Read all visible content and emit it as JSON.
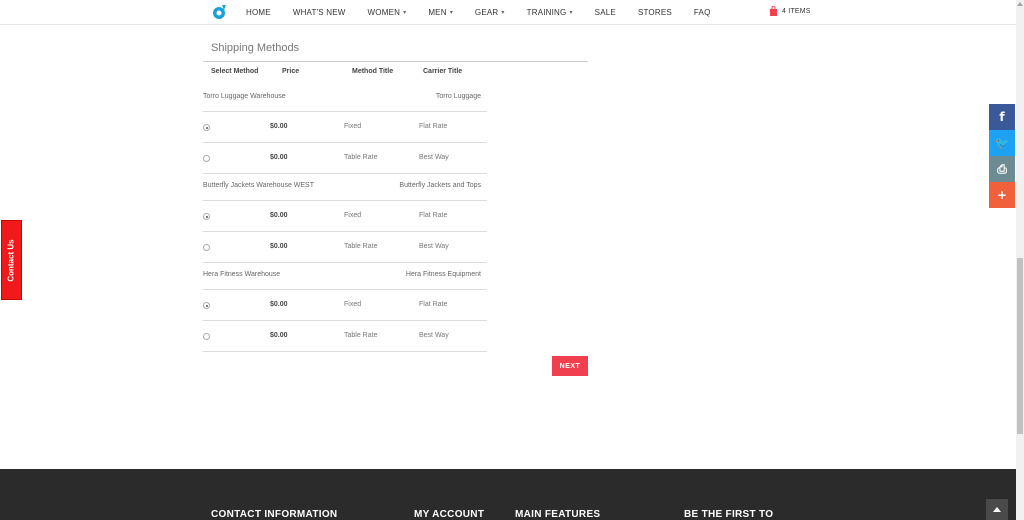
{
  "header": {
    "nav": [
      {
        "label": "HOME",
        "dropdown": false
      },
      {
        "label": "WHAT'S NEW",
        "dropdown": false
      },
      {
        "label": "WOMEN",
        "dropdown": true
      },
      {
        "label": "MEN",
        "dropdown": true
      },
      {
        "label": "GEAR",
        "dropdown": true
      },
      {
        "label": "TRAINING",
        "dropdown": true
      },
      {
        "label": "SALE",
        "dropdown": false
      },
      {
        "label": "STORES",
        "dropdown": false
      },
      {
        "label": "FAQ",
        "dropdown": false
      }
    ],
    "cart_label": "4 ITEMS"
  },
  "shipping": {
    "title": "Shipping Methods",
    "columns": [
      "Select Method",
      "Price",
      "Method Title",
      "Carrier Title"
    ],
    "warehouses": [
      {
        "name": "Torro Luggage Warehouse",
        "carrier": "Torro Luggage",
        "methods": [
          {
            "selected": true,
            "price": "$0.00",
            "method": "Fixed",
            "carrier": "Flat Rate"
          },
          {
            "selected": false,
            "price": "$0.00",
            "method": "Table Rate",
            "carrier": "Best Way"
          }
        ]
      },
      {
        "name": "Butterfly Jackets Warehouse WEST",
        "carrier": "Butterfly Jackets and Tops",
        "methods": [
          {
            "selected": true,
            "price": "$0.00",
            "method": "Fixed",
            "carrier": "Flat Rate"
          },
          {
            "selected": false,
            "price": "$0.00",
            "method": "Table Rate",
            "carrier": "Best Way"
          }
        ]
      },
      {
        "name": "Hera Fitness Warehouse",
        "carrier": "Hera Fitness Equipment",
        "methods": [
          {
            "selected": true,
            "price": "$0.00",
            "method": "Fixed",
            "carrier": "Flat Rate"
          },
          {
            "selected": false,
            "price": "$0.00",
            "method": "Table Rate",
            "carrier": "Best Way"
          }
        ]
      }
    ],
    "next_label": "NEXT"
  },
  "contact_tab": "Contact Us",
  "share": [
    {
      "icon": "facebook-icon",
      "glyph": "f",
      "color": "#3b5998"
    },
    {
      "icon": "twitter-icon",
      "glyph": "🐦",
      "color": "#1da1f2"
    },
    {
      "icon": "print-icon",
      "glyph": "⎙",
      "color": "#6d8b92"
    },
    {
      "icon": "plus-icon",
      "glyph": "+",
      "color": "#f0603a"
    }
  ],
  "footer": {
    "headings": [
      "CONTACT INFORMATION",
      "MY ACCOUNT",
      "MAIN FEATURES",
      "BE THE FIRST TO"
    ]
  },
  "colors": {
    "accent": "#f04050",
    "contact": "#f01a1a",
    "footer": "#2b2b2b"
  }
}
